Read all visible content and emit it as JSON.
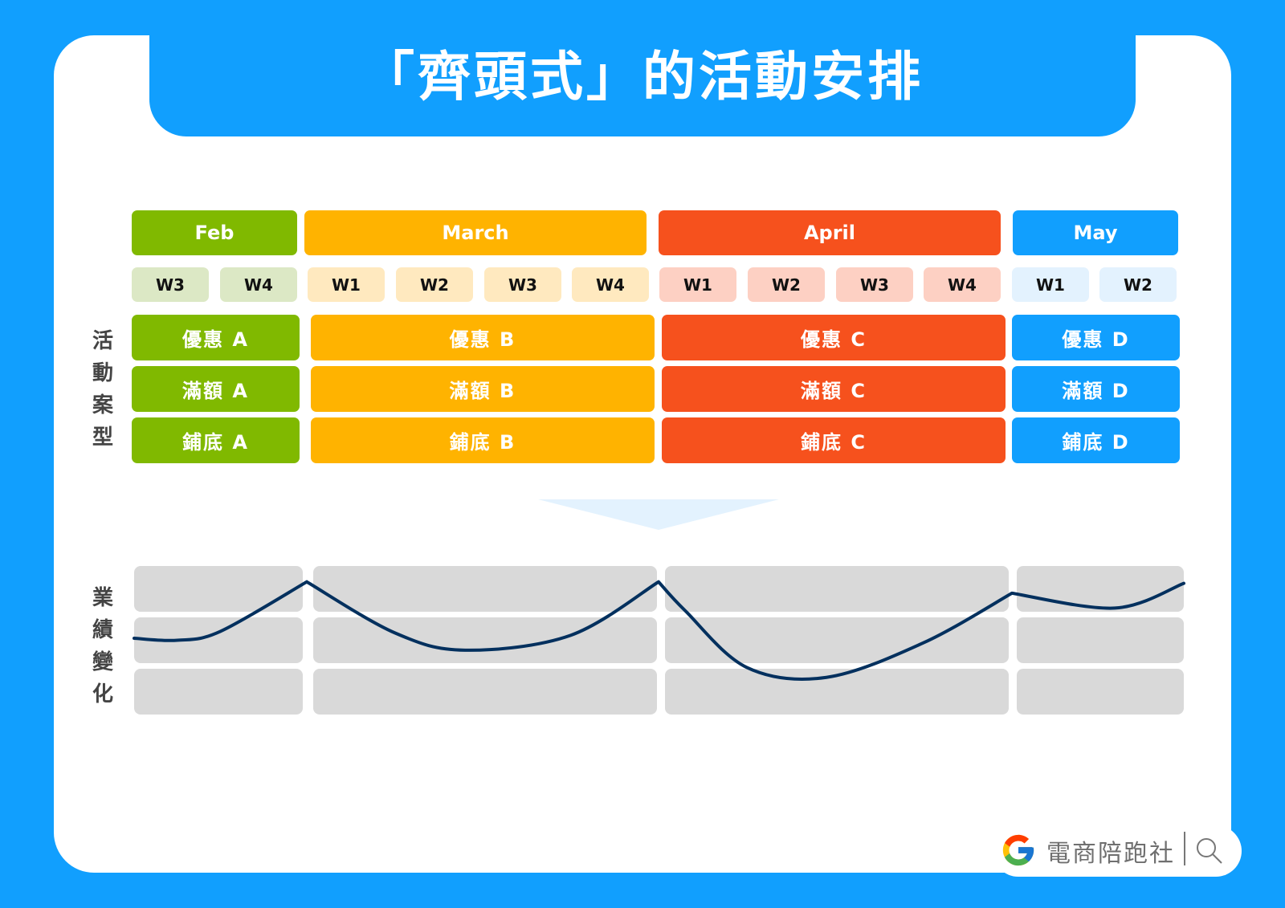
{
  "title": "「齊頭式」的活動安排",
  "colors": {
    "background": "#119ffe",
    "feb": "#80b900",
    "march": "#ffb300",
    "april": "#f6511d",
    "may": "#119ffe",
    "feb_week": "#dce8c5",
    "march_week": "#ffe9bf",
    "april_week": "#fdd0c3",
    "may_week": "#e3f2fe",
    "grey_block": "#d9d9d9",
    "line": "#03305e",
    "arrow": "#e3f2fe"
  },
  "months": [
    {
      "label": "Feb",
      "weeks": [
        "W3",
        "W4"
      ]
    },
    {
      "label": "March",
      "weeks": [
        "W1",
        "W2",
        "W3",
        "W4"
      ]
    },
    {
      "label": "April",
      "weeks": [
        "W1",
        "W2",
        "W3",
        "W4"
      ]
    },
    {
      "label": "May",
      "weeks": [
        "W1",
        "W2"
      ]
    }
  ],
  "activity_label": [
    "活",
    "動",
    "案",
    "型"
  ],
  "activities": [
    [
      "優惠 A",
      "滿額 A",
      "鋪底 A"
    ],
    [
      "優惠 B",
      "滿額 B",
      "鋪底 B"
    ],
    [
      "優惠 C",
      "滿額 C",
      "鋪底 C"
    ],
    [
      "優惠 D",
      "滿額 D",
      "鋪底 D"
    ]
  ],
  "performance_label": [
    "業",
    "績",
    "變",
    "化"
  ],
  "chart_data": {
    "type": "line",
    "title": "業績變化",
    "xlabel": "",
    "ylabel": "業績變化",
    "x_segments": [
      "Feb",
      "March",
      "April",
      "May"
    ],
    "grid": true,
    "y_levels": 3,
    "ylim": [
      0,
      3
    ],
    "series": [
      {
        "name": "業績",
        "points": [
          {
            "x": 0.0,
            "y": 1.54
          },
          {
            "x": 0.25,
            "y": 1.5
          },
          {
            "x": 0.5,
            "y": 1.68
          },
          {
            "x": 1.0,
            "y": 2.68
          },
          {
            "x": 1.5,
            "y": 1.65
          },
          {
            "x": 1.9,
            "y": 1.3
          },
          {
            "x": 2.5,
            "y": 1.6
          },
          {
            "x": 3.0,
            "y": 2.68
          },
          {
            "x": 3.15,
            "y": 2.1
          },
          {
            "x": 3.5,
            "y": 0.95
          },
          {
            "x": 3.95,
            "y": 0.75
          },
          {
            "x": 4.5,
            "y": 1.45
          },
          {
            "x": 5.0,
            "y": 2.45
          },
          {
            "x": 5.6,
            "y": 2.15
          },
          {
            "x": 6.0,
            "y": 2.65
          }
        ]
      }
    ]
  },
  "brand": {
    "logo": "google-g-icon",
    "name": "電商陪跑社",
    "search_icon": "search-icon"
  }
}
